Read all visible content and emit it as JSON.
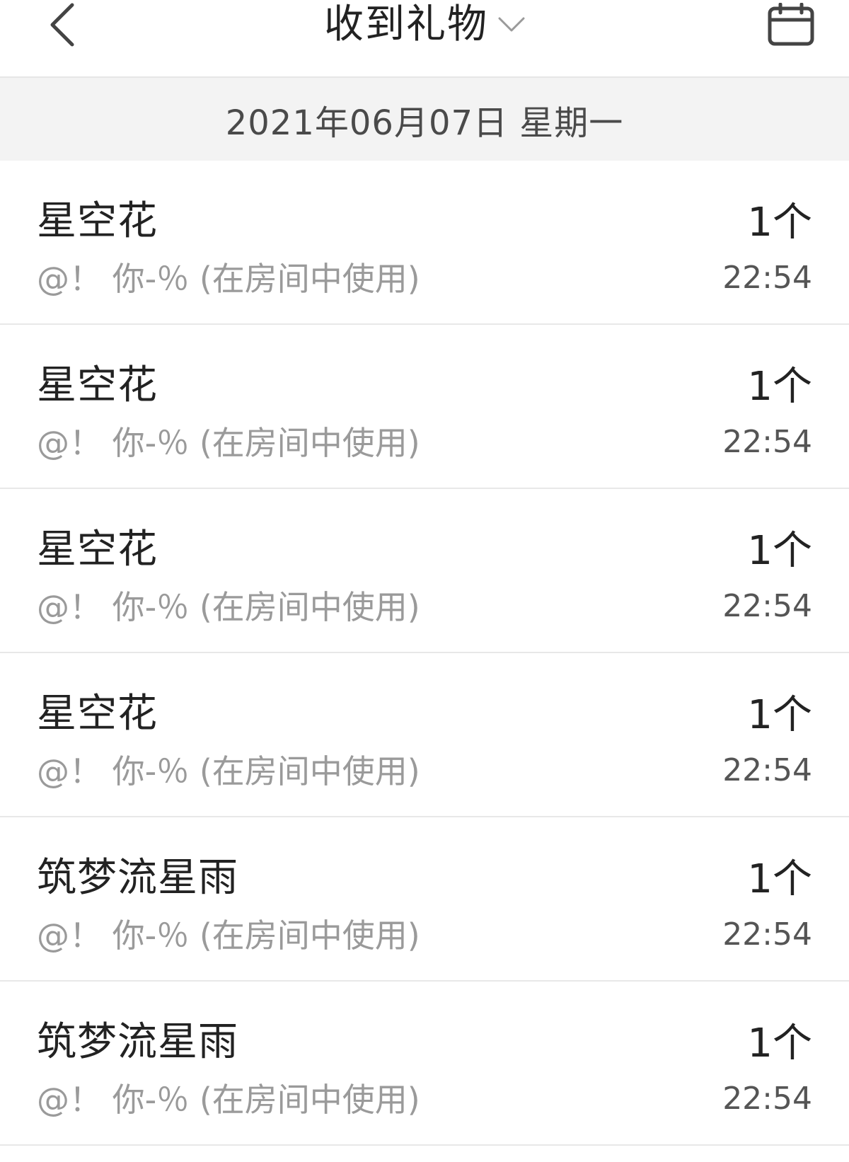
{
  "header": {
    "title": "收到礼物",
    "icons": {
      "back": "chevron-left-icon",
      "title_caret": "chevron-down-icon",
      "calendar": "calendar-icon"
    }
  },
  "date_bar": {
    "date": "2021年06月07日 星期一"
  },
  "gifts": [
    {
      "name": "星空花",
      "desc": "@！ 你-％ (在房间中使用)",
      "count": "1个",
      "time": "22:54"
    },
    {
      "name": "星空花",
      "desc": "@！ 你-％ (在房间中使用)",
      "count": "1个",
      "time": "22:54"
    },
    {
      "name": "星空花",
      "desc": "@！ 你-％ (在房间中使用)",
      "count": "1个",
      "time": "22:54"
    },
    {
      "name": "星空花",
      "desc": "@！ 你-％ (在房间中使用)",
      "count": "1个",
      "time": "22:54"
    },
    {
      "name": "筑梦流星雨",
      "desc": "@！ 你-％ (在房间中使用)",
      "count": "1个",
      "time": "22:54"
    },
    {
      "name": "筑梦流星雨",
      "desc": "@！ 你-％ (在房间中使用)",
      "count": "1个",
      "time": "22:54"
    }
  ],
  "colors": {
    "background": "#ffffff",
    "date_bar_bg": "#f3f3f3",
    "primary_text": "#222222",
    "secondary_text": "#9a9a9a",
    "divider": "#e8e8e8"
  }
}
